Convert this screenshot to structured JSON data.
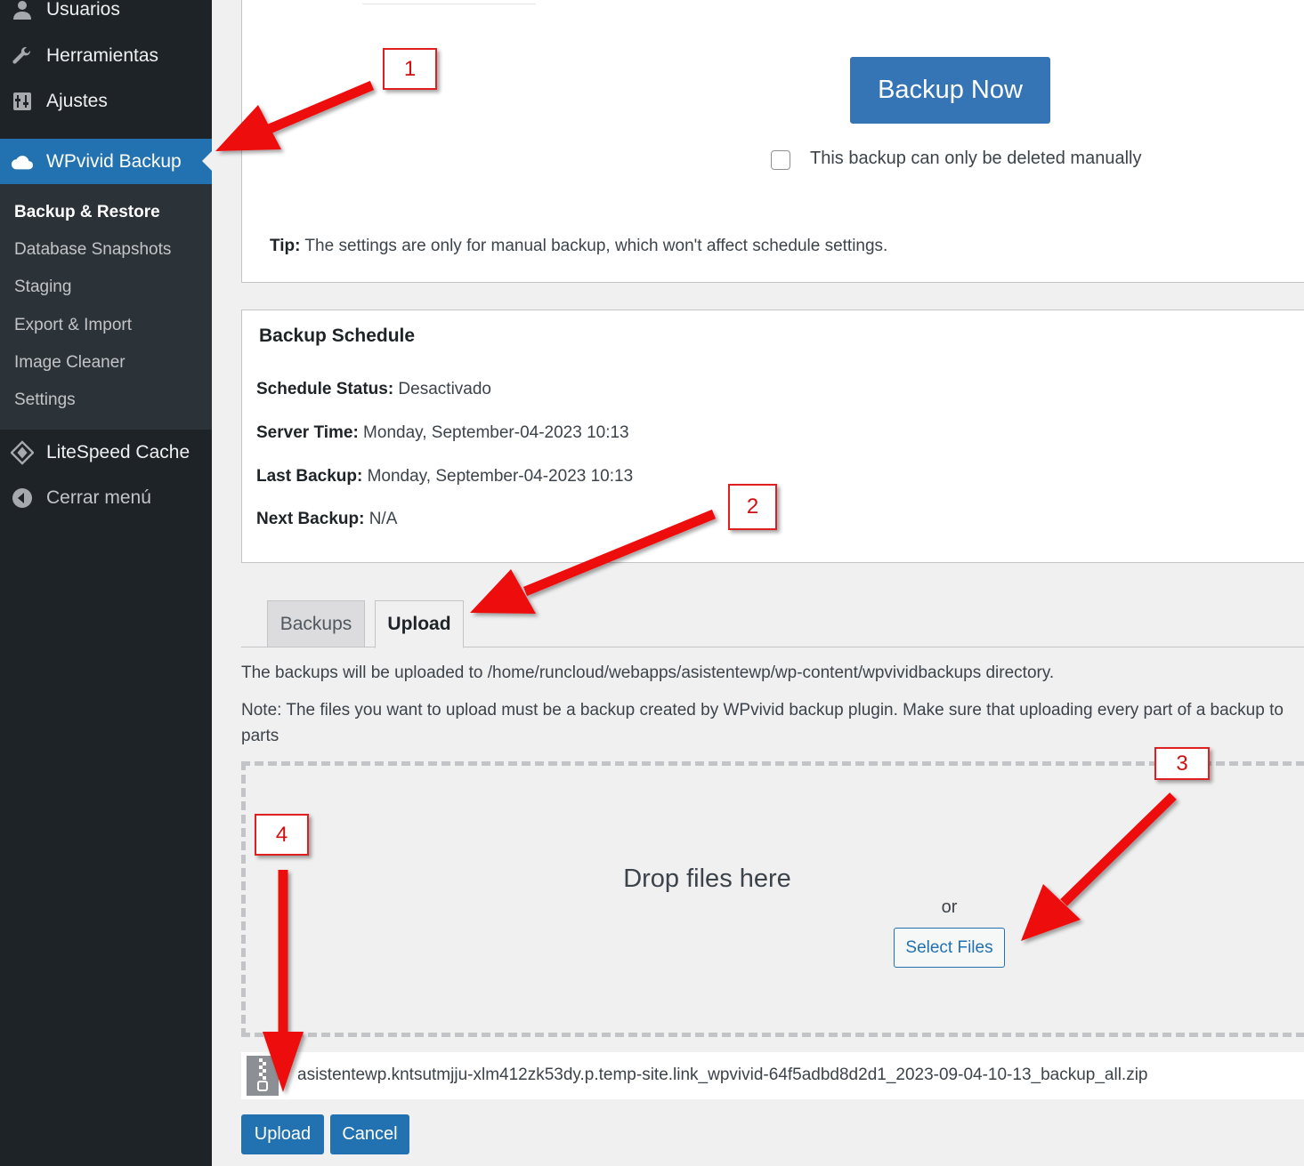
{
  "sidebar": {
    "menu": [
      {
        "label": "Usuarios",
        "icon": "users-icon"
      },
      {
        "label": "Herramientas",
        "icon": "wrench-icon"
      },
      {
        "label": "Ajustes",
        "icon": "settings-icon"
      },
      {
        "label": "WPvivid Backup",
        "icon": "cloud-icon"
      },
      {
        "label": "LiteSpeed Cache",
        "icon": "litespeed-diamond-icon"
      },
      {
        "label": "Cerrar menú",
        "icon": "collapse-arrow-icon"
      }
    ],
    "submenu": [
      "Backup & Restore",
      "Database Snapshots",
      "Staging",
      "Export & Import",
      "Image Cleaner",
      "Settings"
    ],
    "current_submenu": "Backup & Restore"
  },
  "backup": {
    "backup_now_label": "Backup Now",
    "manual_delete_label": "This backup can only be deleted manually",
    "manual_delete_checked": false,
    "tip_label": "Tip:",
    "tip_text": " The settings are only for manual backup, which won't affect schedule settings."
  },
  "schedule": {
    "title": "Backup Schedule",
    "rows": [
      {
        "label": "Schedule Status:",
        "value": " Desactivado"
      },
      {
        "label": "Server Time:",
        "value": " Monday, September-04-2023 10:13"
      },
      {
        "label": "Last Backup:",
        "value": " Monday, September-04-2023 10:13"
      },
      {
        "label": "Next Backup:",
        "value": " N/A"
      }
    ]
  },
  "tabs": [
    {
      "label": "Backups",
      "active": false
    },
    {
      "label": "Upload",
      "active": true
    }
  ],
  "upload": {
    "dir_note": "The backups will be uploaded to /home/runcloud/webapps/asistentewp/wp-content/wpvividbackups directory.",
    "note_line1": "Note: The files you want to upload must be a backup created by WPvivid backup plugin. Make sure that uploading every part of a backup to",
    "note_line2": "parts",
    "drop_text": "Drop files here",
    "or_text": "or",
    "select_files_label": "Select Files",
    "file_name": "asistentewp.kntsutmjju-xlm412zk53dy.p.temp-site.link_wpvivid-64f5adbd8d2d1_2023-09-04-10-13_backup_all.zip",
    "upload_label": "Upload",
    "cancel_label": "Cancel"
  },
  "annotations": [
    "1",
    "2",
    "3",
    "4"
  ],
  "colors": {
    "sidebar_bg": "#1d2327",
    "submenu_bg": "#2c3338",
    "accent": "#2271b1",
    "annotation_red": "#e02020"
  }
}
